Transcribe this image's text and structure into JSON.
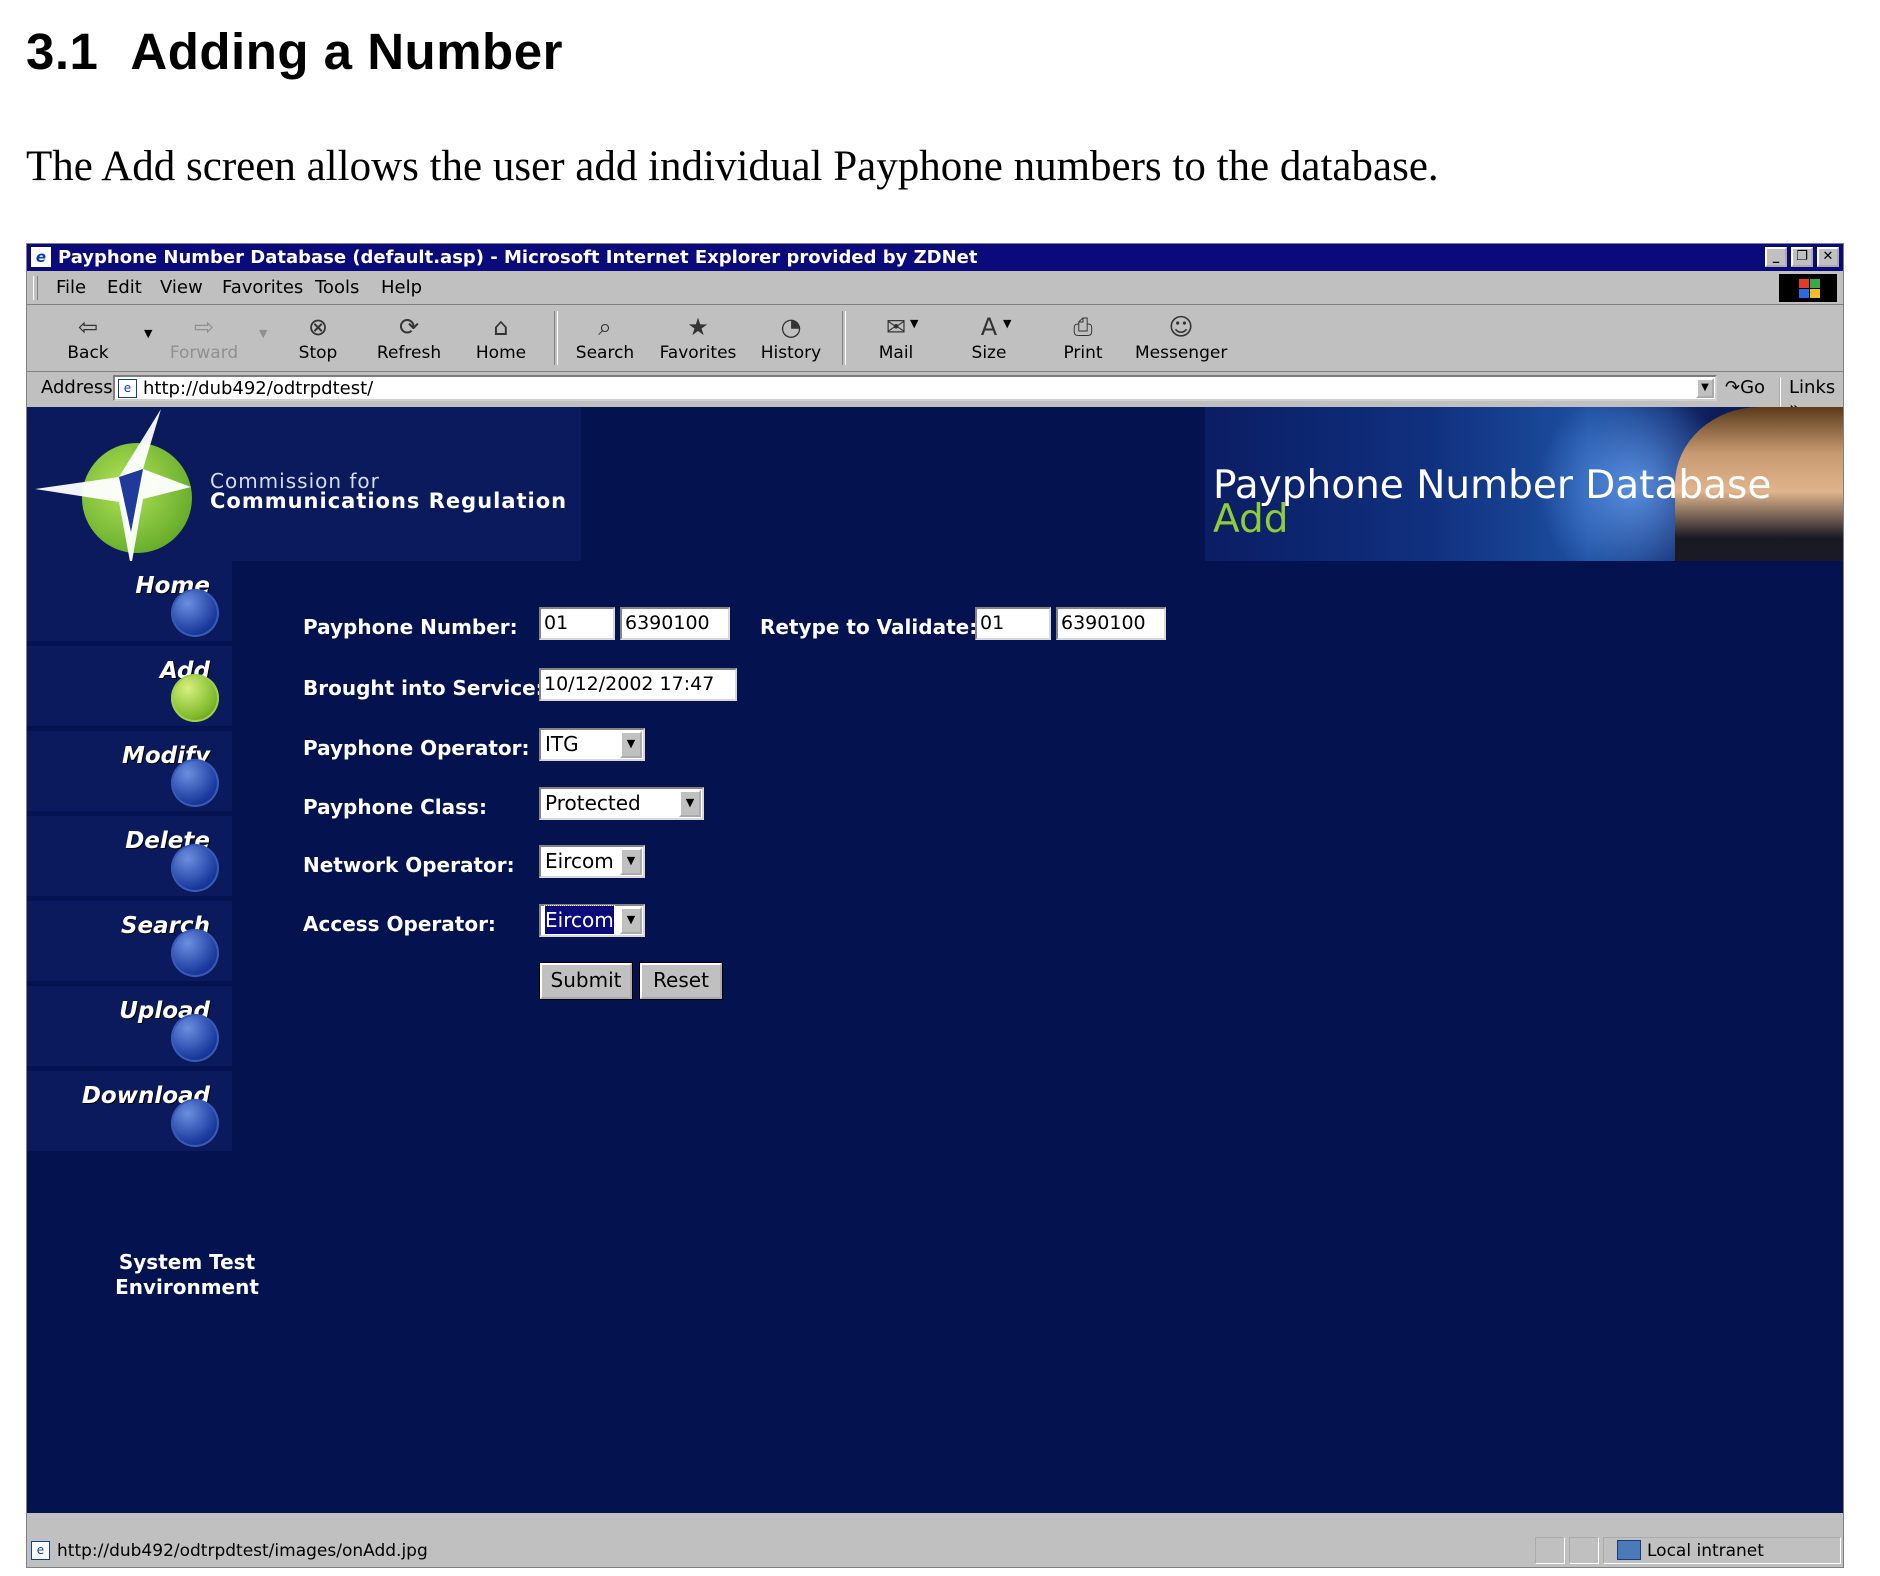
{
  "document": {
    "section_number": "3.1",
    "section_title": "Adding a Number",
    "paragraph": "The Add screen allows the user add individual Payphone numbers to the database."
  },
  "window": {
    "title": "Payphone Number Database (default.asp) - Microsoft Internet Explorer provided by ZDNet",
    "minimize": "_",
    "restore": "❐",
    "close": "✕"
  },
  "menu": [
    "File",
    "Edit",
    "View",
    "Favorites",
    "Tools",
    "Help"
  ],
  "toolbar": {
    "back": "Back",
    "forward": "Forward",
    "stop": "Stop",
    "refresh": "Refresh",
    "home": "Home",
    "search": "Search",
    "favorites": "Favorites",
    "history": "History",
    "mail": "Mail",
    "size": "Size",
    "print": "Print",
    "messenger": "Messenger"
  },
  "address": {
    "label": "Address",
    "url": "http://dub492/odtrpdtest/",
    "go": "Go",
    "links": "Links"
  },
  "header": {
    "org_line1": "Commission for",
    "org_line2": "Communications Regulation",
    "app_title": "Payphone Number Database",
    "page_name": "Add"
  },
  "nav": {
    "items": [
      {
        "label": "Home"
      },
      {
        "label": "Add"
      },
      {
        "label": "Modify"
      },
      {
        "label": "Delete"
      },
      {
        "label": "Search"
      },
      {
        "label": "Upload"
      },
      {
        "label": "Download"
      }
    ],
    "active": "Add",
    "env_line1": "System Test",
    "env_line2": "Environment"
  },
  "form": {
    "payphone_number_label": "Payphone Number:",
    "payphone_area": "01",
    "payphone_local": "6390100",
    "retype_label": "Retype to Validate:",
    "retype_area": "01",
    "retype_local": "6390100",
    "service_label": "Brought into Service:",
    "service_value": "10/12/2002 17:47",
    "operator_label": "Payphone Operator:",
    "operator_value": "ITG",
    "class_label": "Payphone Class:",
    "class_value": "Protected",
    "network_label": "Network Operator:",
    "network_value": "Eircom",
    "access_label": "Access Operator:",
    "access_value": "Eircom",
    "submit": "Submit",
    "reset": "Reset"
  },
  "status": {
    "text": "http://dub492/odtrpdtest/images/onAdd.jpg",
    "zone": "Local intranet"
  }
}
